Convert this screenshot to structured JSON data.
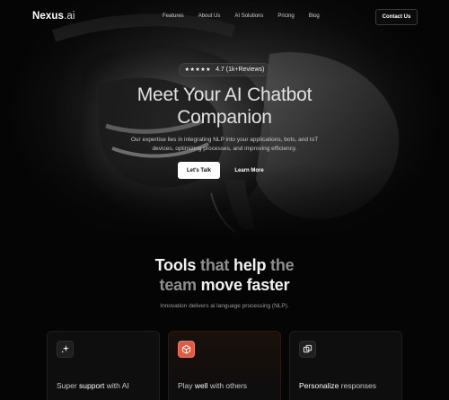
{
  "nav": {
    "logo_main": "Nexus",
    "logo_domain": ".ai",
    "links": [
      "Features",
      "About Us",
      "AI Solutions",
      "Pricing",
      "Blog"
    ],
    "contact_label": "Contact Us"
  },
  "hero": {
    "rating_stars": "★★★★★",
    "rating_value": 4.7,
    "rating_text": "4.7 (1k+Reviews)",
    "title_line1": "Meet Your AI Chatbot",
    "title_line2": "Companion",
    "subtitle": "Our expertise lies in integrating NLP into your applications, bots, and IoT devices, optimizing processes, and improving efficiency.",
    "primary_button": "Let's Talk",
    "secondary_button": "Learn More"
  },
  "tools": {
    "title_line1_a": "Tools",
    "title_line1_b": " that ",
    "title_line1_c": "help",
    "title_line1_d": " the",
    "title_line2_a": "team ",
    "title_line2_b": "move faster",
    "subtitle": "Innovation delivers ai language processing (NLP).",
    "cards": [
      {
        "title_a": "Super ",
        "title_b": "support",
        "title_c": " with AI",
        "icon": "sparkle-icon"
      },
      {
        "title_a": "Play ",
        "title_b": "well",
        "title_c": " with others",
        "icon": "cube-icon"
      },
      {
        "title_a": "",
        "title_b": "Personalize",
        "title_c": " responses",
        "icon": "layers-icon"
      }
    ]
  },
  "colors": {
    "background": "#050505",
    "accent": "#e05a44",
    "primary_button": "#ffffff"
  }
}
